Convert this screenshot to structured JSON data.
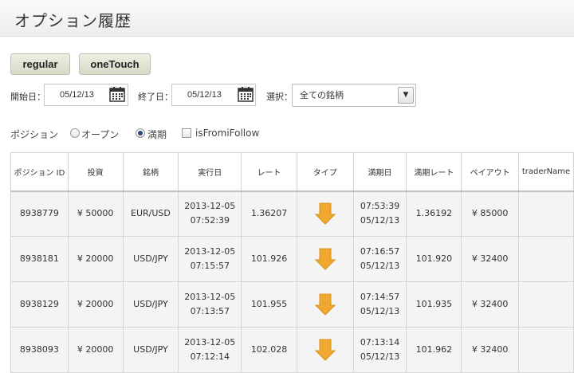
{
  "page_title": "オプション履歴",
  "tabs": {
    "regular": "regular",
    "onetouch": "oneTouch"
  },
  "filters": {
    "start_label": "開始日：",
    "start_value": "05/12/13",
    "end_label": "終了日：",
    "end_value": "05/12/13",
    "select_label": "選択：",
    "select_value": "全ての銘柄"
  },
  "position": {
    "label": "ポジション",
    "open_label": "オープン",
    "expired_label": "満期",
    "expired_checked": true,
    "follow_label": "isFromiFollow",
    "follow_checked": false
  },
  "table": {
    "headers": [
      "ポジション ID",
      "投資",
      "銘柄",
      "実行日",
      "レート",
      "タイプ",
      "満期日",
      "満期レート",
      "ペイアウト",
      "traderName"
    ],
    "rows": [
      {
        "id": "8938779",
        "investment": "¥ 50000",
        "symbol": "EUR/USD",
        "exec_date": "2013-12-05",
        "exec_time": "07:52:39",
        "rate": "1.36207",
        "type": "down-arrow-icon",
        "expiry_time": "07:53:39",
        "expiry_date": "05/12/13",
        "expiry_rate": "1.36192",
        "payout": "¥ 85000",
        "trader": ""
      },
      {
        "id": "8938181",
        "investment": "¥ 20000",
        "symbol": "USD/JPY",
        "exec_date": "2013-12-05",
        "exec_time": "07:15:57",
        "rate": "101.926",
        "type": "down-arrow-icon",
        "expiry_time": "07:16:57",
        "expiry_date": "05/12/13",
        "expiry_rate": "101.920",
        "payout": "¥ 32400",
        "trader": ""
      },
      {
        "id": "8938129",
        "investment": "¥ 20000",
        "symbol": "USD/JPY",
        "exec_date": "2013-12-05",
        "exec_time": "07:13:57",
        "rate": "101.955",
        "type": "down-arrow-icon",
        "expiry_time": "07:14:57",
        "expiry_date": "05/12/13",
        "expiry_rate": "101.935",
        "payout": "¥ 32400",
        "trader": ""
      },
      {
        "id": "8938093",
        "investment": "¥ 20000",
        "symbol": "USD/JPY",
        "exec_date": "2013-12-05",
        "exec_time": "07:12:14",
        "rate": "102.028",
        "type": "down-arrow-icon",
        "expiry_time": "07:13:14",
        "expiry_date": "05/12/13",
        "expiry_rate": "101.962",
        "payout": "¥ 32400",
        "trader": ""
      }
    ]
  },
  "colors": {
    "arrow": "#f0a830",
    "header_bg": "#f3f3f3",
    "row_bg": "#f4f4f4"
  }
}
